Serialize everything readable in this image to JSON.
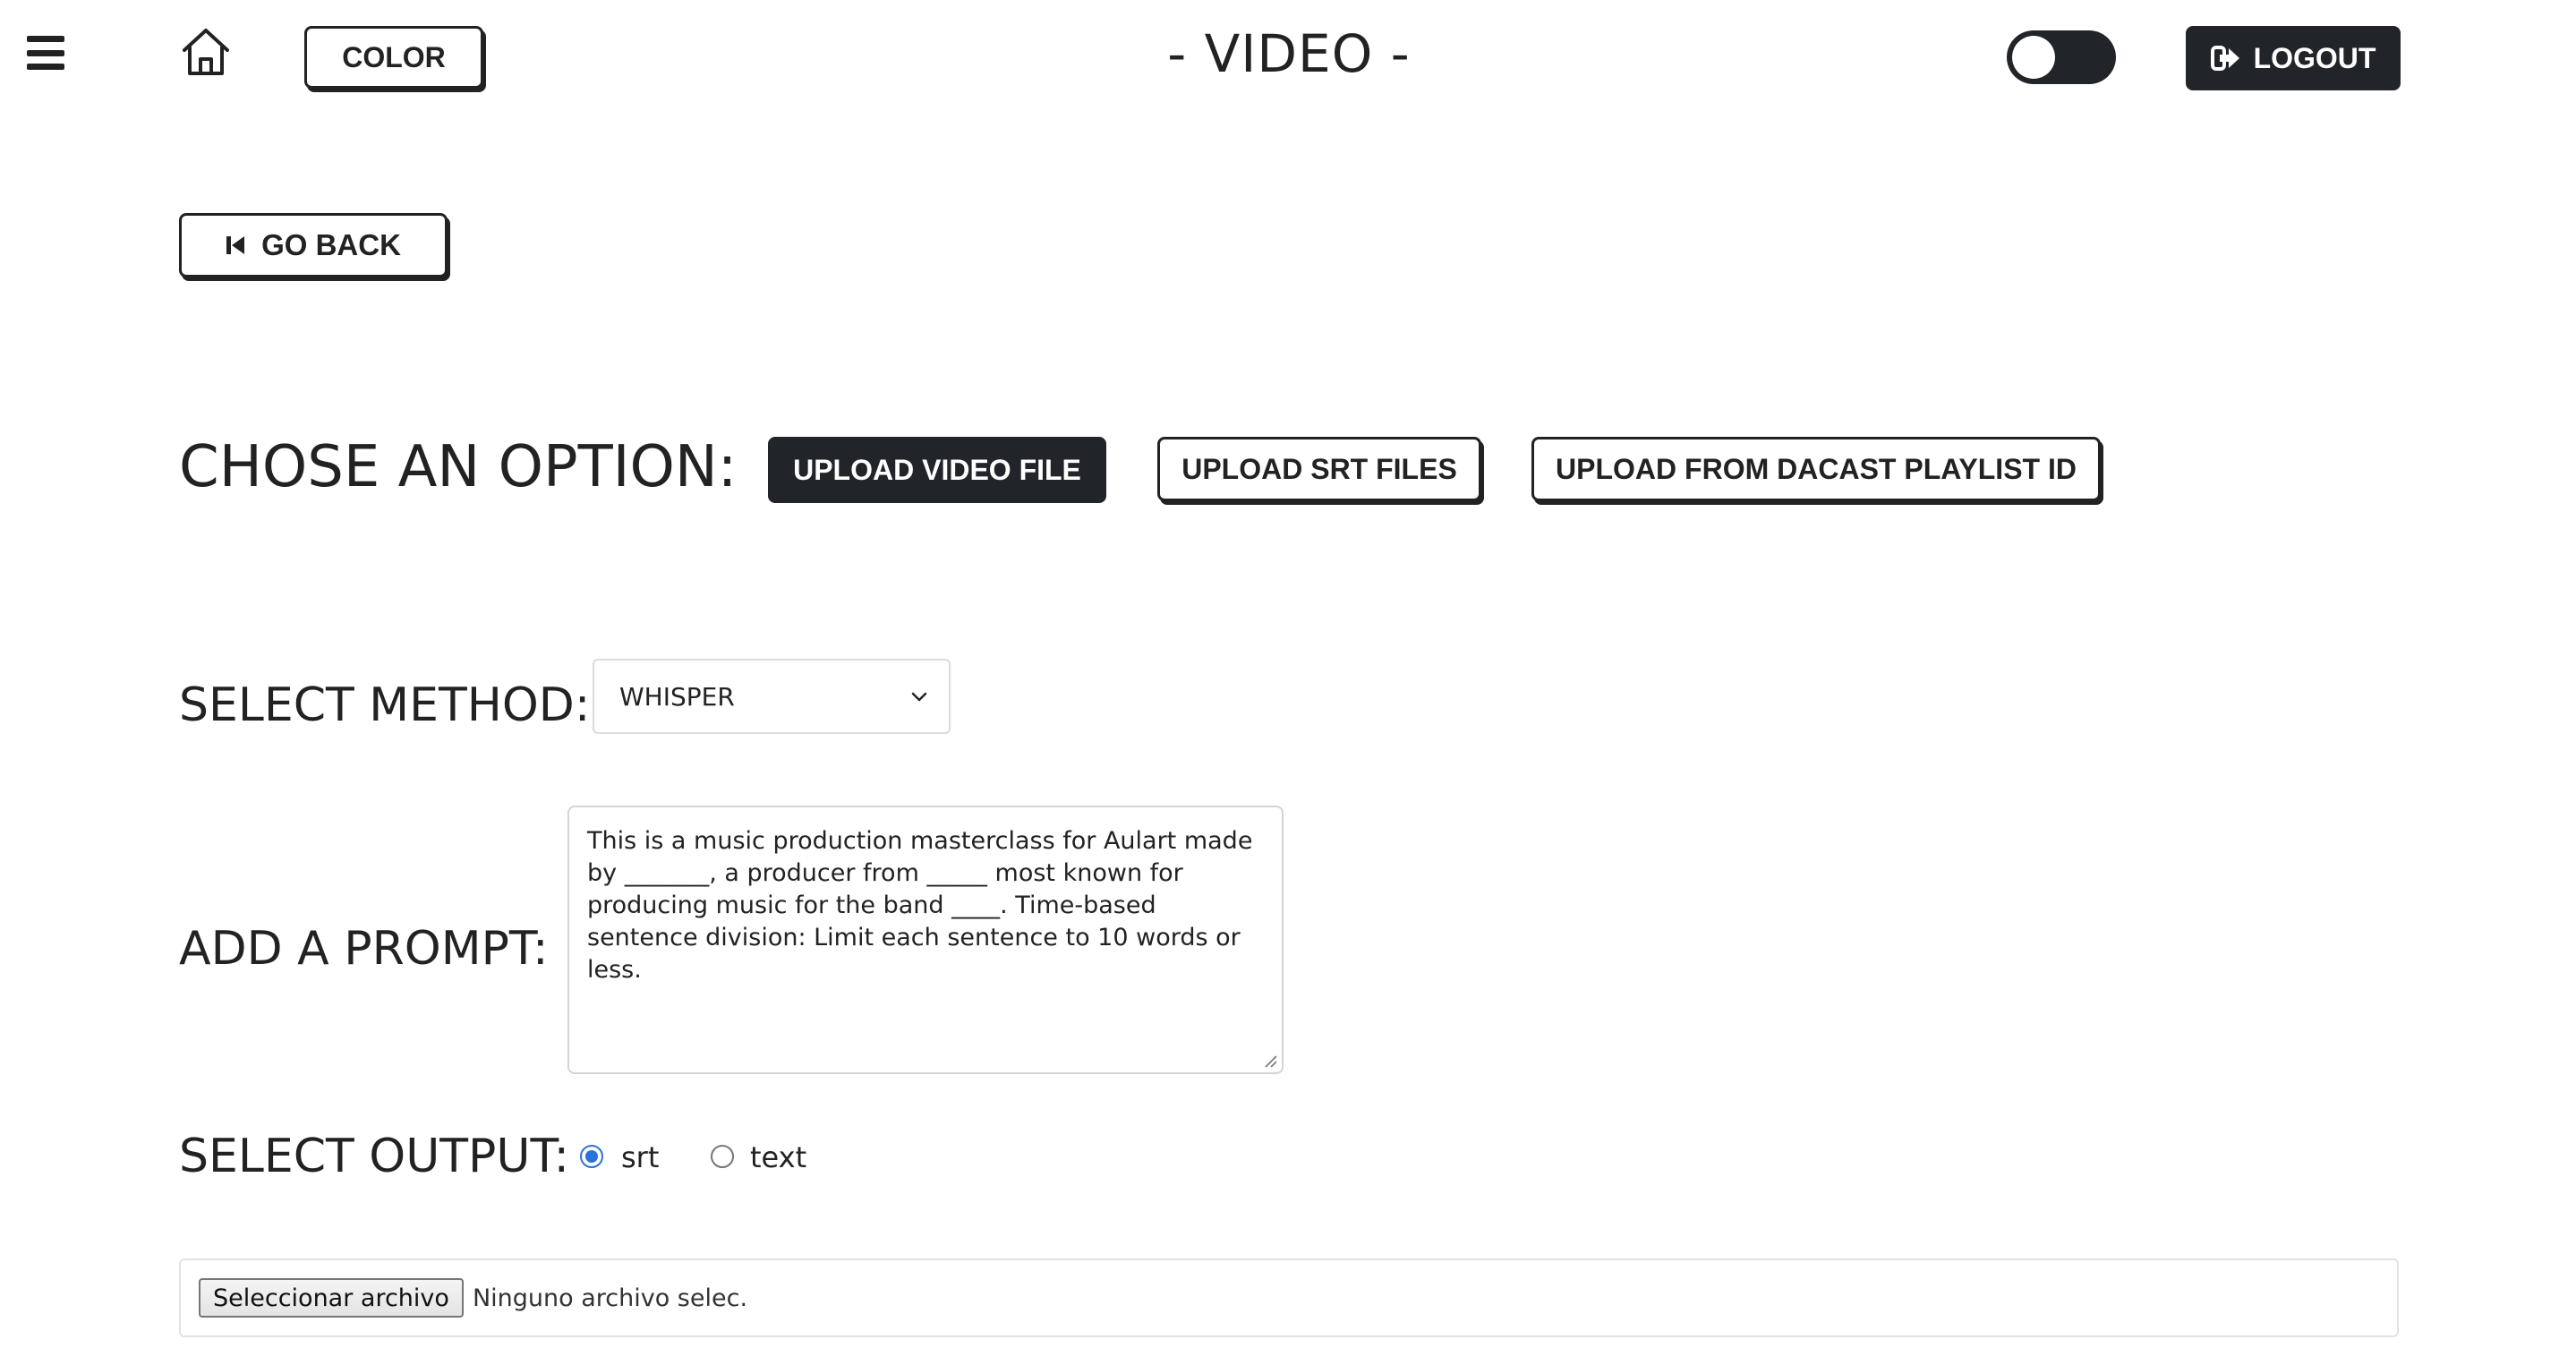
{
  "header": {
    "menu_icon": "hamburger-menu-icon",
    "home_icon": "home-icon",
    "color_label": "COLOR",
    "title": "- VIDEO -",
    "theme_toggle": {
      "checked": false
    },
    "logout_label": "LOGOUT",
    "logout_icon": "logout-icon"
  },
  "nav": {
    "go_back_label": "GO BACK",
    "go_back_icon": "skip-back-icon"
  },
  "options": {
    "heading": "CHOSE AN OPTION:",
    "buttons": [
      {
        "label": "UPLOAD VIDEO FILE",
        "active": true
      },
      {
        "label": "UPLOAD SRT FILES",
        "active": false
      },
      {
        "label": "UPLOAD FROM DACAST PLAYLIST ID",
        "active": false
      }
    ]
  },
  "method": {
    "label": "SELECT METHOD:",
    "selected": "WHISPER"
  },
  "prompt": {
    "label": "ADD A PROMPT:",
    "value": "This is a music production masterclass for Aulart made by _______, a producer from _____ most known for producing music for the band ____. Time-based sentence division: Limit each sentence to 10 words or less."
  },
  "output": {
    "label": "SELECT OUTPUT:",
    "options": [
      {
        "label": "srt",
        "checked": true
      },
      {
        "label": "text",
        "checked": false
      }
    ]
  },
  "file": {
    "button_label": "Seleccionar archivo",
    "status": "Ninguno archivo selec."
  },
  "colors": {
    "dark": "#212529",
    "text": "#222222",
    "radio_accent": "#2a73d8"
  }
}
